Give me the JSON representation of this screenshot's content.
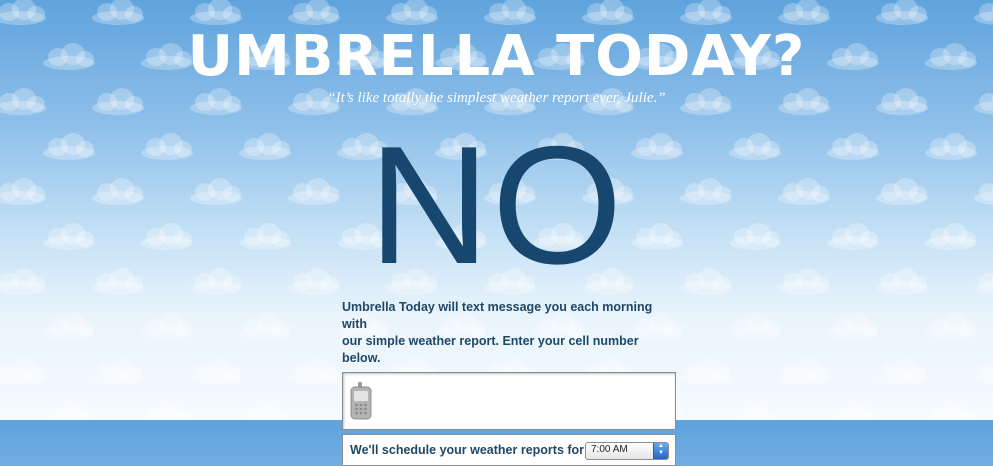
{
  "header": {
    "title": "UMBRELLA TODAY?",
    "tagline": "“It’s like totally the simplest weather report ever, Julie.”"
  },
  "answer": "NO",
  "signup": {
    "description_line1": "Umbrella Today will text message you each morning with",
    "description_line2": "our simple weather report. Enter your cell number below.",
    "phone_placeholder": "",
    "phone_icon": "cell-phone-icon",
    "schedule_label": "We'll schedule your weather reports for",
    "schedule_time": "7:00 AM"
  },
  "colors": {
    "sky_top": "#5fa3dd",
    "sky_bottom": "#f6fbff",
    "answer": "#17466e",
    "text": "#1f4766",
    "title": "#ffffff"
  }
}
